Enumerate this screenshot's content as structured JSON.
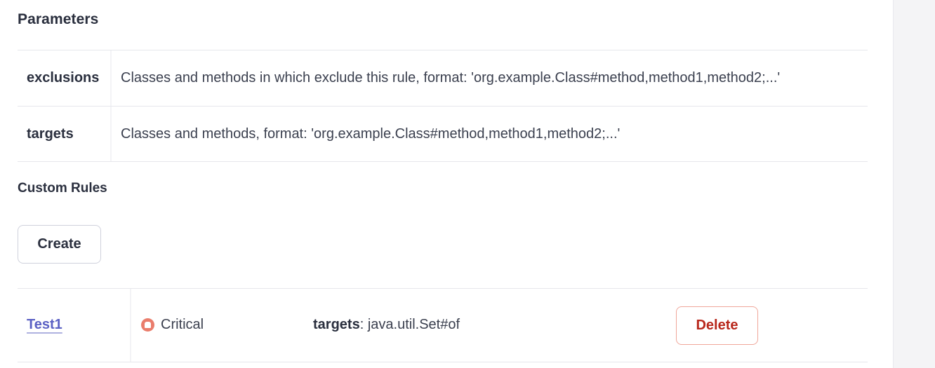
{
  "parameters": {
    "title": "Parameters",
    "rows": [
      {
        "name": "exclusions",
        "description": "Classes and methods in which exclude this rule, format: 'org.example.Class#method,method1,method2;...'"
      },
      {
        "name": "targets",
        "description": "Classes and methods, format: 'org.example.Class#method,method1,method2;...'"
      }
    ]
  },
  "custom_rules": {
    "title": "Custom Rules",
    "create_label": "Create",
    "rules": [
      {
        "name": "Test1",
        "severity": "Critical",
        "severity_icon": "critical-severity-icon",
        "param_key": "targets",
        "param_separator": ": ",
        "param_value": "java.util.Set#of",
        "delete_label": "Delete"
      }
    ]
  },
  "colors": {
    "link": "#5b61c4",
    "critical": "#ea7d6c",
    "danger": "#b8271b"
  }
}
